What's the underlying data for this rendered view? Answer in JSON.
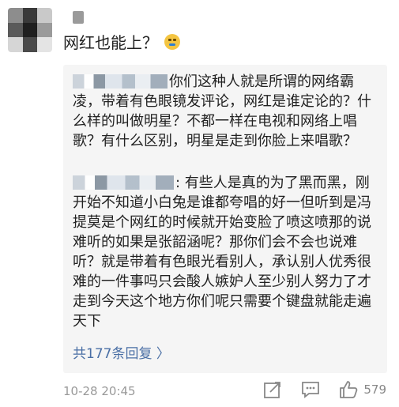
{
  "comment": {
    "text": "网红也能上？"
  },
  "replies": [
    {
      "text": "你们这种人就是所谓的网络霸凌，带着有色眼镜发评论，网红是谁定论的？什么样的叫做明星？不都一样在电视和网络上唱歌？有什么区别，明星是走到你脸上来唱歌？"
    },
    {
      "text": ": 有些人是真的为了黑而黑，刚开始不知道小白兔是谁都夸唱的好一但听到是冯提莫是个网红的时候就开始变脸了喷这喷那的说难听的如果是张韶涵呢？那你们会不会也说难听？就是带着有色眼光看别人，承认别人优秀很难的一件事吗只会酸人嫉妒人至少别人努力了才走到今天这个地方你们呢只需要个键盘就能走遍天下"
    }
  ],
  "more_replies": "共177条回复 〉",
  "footer": {
    "time": "10-28 20:45",
    "like_count": "579"
  },
  "icons": [
    "emoji-icon",
    "share-icon",
    "comment-icon",
    "like-icon"
  ]
}
